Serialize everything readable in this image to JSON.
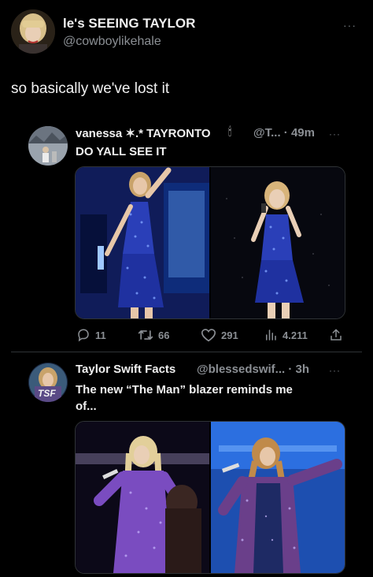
{
  "main_tweet": {
    "display_name": "le's SEEING TAYLOR",
    "handle": "@cowboylikehale",
    "more": "···",
    "text": "so basically we've lost it"
  },
  "quote1": {
    "display_name": "vanessa ✶.* TAYRONTO",
    "emoji": "🕯",
    "handle_time": "@T... · 49m",
    "more": "···",
    "text": "DO YALL SEE IT",
    "actions": {
      "replies": "11",
      "reposts": "66",
      "likes": "291",
      "views": "4.211"
    }
  },
  "quote2": {
    "display_name": "Taylor Swift Facts",
    "handle_time": "@blessedswif... · 3h",
    "more": "···",
    "avatar_label": "TSF",
    "text_line1": "The new “The Man” blazer reminds me",
    "text_line2": "of..."
  },
  "colors": {
    "background": "#000000",
    "text": "#e7e9ea",
    "muted": "#8b8f94",
    "sequin_blue": "#2a3fb8",
    "sequin_purple": "#7a4cc0"
  }
}
